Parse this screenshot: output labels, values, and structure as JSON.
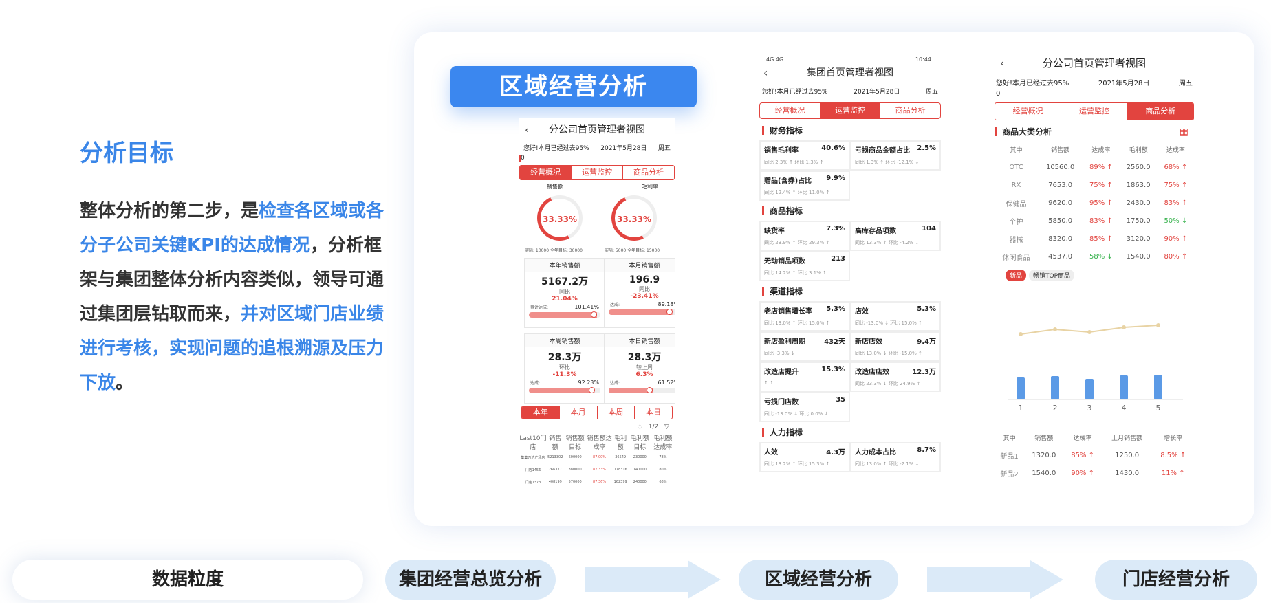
{
  "left": {
    "title": "分析目标",
    "paragraph": [
      {
        "t": "整体分析的第二步，是",
        "hl": false
      },
      {
        "t": "检查各区域或各分子公司关键KPI的达成情况",
        "hl": true
      },
      {
        "t": "，分析框架与集团整体分析内容类似，领导可通过集团层钻取而来，",
        "hl": false
      },
      {
        "t": "并对区域门店业绩进行考核，实现问题的追根溯源及压力下放",
        "hl": true
      },
      {
        "t": "。",
        "hl": false
      }
    ]
  },
  "tag_label": "区域经营分析",
  "phone1": {
    "title": "分公司首页管理者视图",
    "greet": "您好!本月已经过去95%",
    "date": "2021年5月28日",
    "weekday": "周五",
    "zero": "0",
    "tabs": [
      "经营概况",
      "运营监控",
      "商品分析"
    ],
    "gauges": [
      {
        "label": "销售额",
        "value": "33.33%",
        "foot": "实际: 10000    全年目标: 30000"
      },
      {
        "label": "毛利率",
        "value": "33.33%",
        "foot": "实际: 5000    全年目标: 15000"
      }
    ],
    "cards": [
      {
        "title": "本年销售额",
        "value": "5167.2万",
        "sub": "同比",
        "pct": "21.04%",
        "k": "累计达成:",
        "kv": "101.41%",
        "fill": 0.95
      },
      {
        "title": "本月销售额",
        "value": "196.9",
        "sub": "同比",
        "pct": "-23.41%",
        "k": "达成:",
        "kv": "89.18%",
        "fill": 0.89
      },
      {
        "title": "本周销售额",
        "value": "28.3万",
        "sub": "环比",
        "pct": "-11.3%",
        "k": "达成:",
        "kv": "92.23%",
        "fill": 0.92
      },
      {
        "title": "本日销售额",
        "value": "28.3万",
        "sub": "较上周",
        "pct": "6.3%",
        "k": "达成:",
        "kv": "61.52%",
        "fill": 0.62
      }
    ],
    "period_tabs": [
      "本年",
      "本月",
      "本周",
      "本日"
    ],
    "pager": "1/2",
    "table_head": [
      "Last10门店",
      "销售额",
      "销售额目标",
      "销售额达成率",
      "毛利额",
      "毛利额目标",
      "毛利额达成率"
    ],
    "table_rows": [
      [
        "集集万达广场店",
        "5213302",
        "600000",
        "87.00%",
        "36549",
        "230000",
        "78%"
      ],
      [
        "门店1456",
        "266377",
        "380000",
        "87.33%",
        "178316",
        "140000",
        "80%"
      ],
      [
        "门店1373",
        "408199",
        "570000",
        "87.36%",
        "162399",
        "240000",
        "68%"
      ]
    ]
  },
  "phone2": {
    "status_left": "4G 4G",
    "status_right": "10:44",
    "title": "集团首页管理者视图",
    "greet": "您好!本月已经过去95%",
    "date": "2021年5月28日",
    "weekday": "周五",
    "tabs": [
      "经营概况",
      "运营监控",
      "商品分析"
    ],
    "sections": [
      {
        "name": "财务指标",
        "items": [
          {
            "k": "销售毛利率",
            "v": "40.6%",
            "d": "同比 2.3% ↑  环比 1.3% ↑"
          },
          {
            "k": "亏损商品金额占比",
            "v": "2.5%",
            "d": "同比 1.3% ↑  环比 -12.1% ↓"
          },
          {
            "k": "赠品(含券)占比",
            "v": "9.9%",
            "d": "同比 12.4% ↑  环比 11.0% ↑"
          }
        ]
      },
      {
        "name": "商品指标",
        "items": [
          {
            "k": "缺货率",
            "v": "7.3%",
            "d": "同比 23.9% ↑  环比 29.3% ↑"
          },
          {
            "k": "高库存品项数",
            "v": "104",
            "d": "同比 13.3% ↑  环比 -4.2% ↓"
          },
          {
            "k": "无动销品项数",
            "v": "213",
            "d": "同比 14.2% ↑  环比 3.1% ↑"
          }
        ]
      },
      {
        "name": "渠道指标",
        "items": [
          {
            "k": "老店销售增长率",
            "v": "5.3%",
            "d": "同比 13.0% ↑  环比 15.0% ↑"
          },
          {
            "k": "店效",
            "v": "5.3%",
            "d": "同比 -13.0% ↓  环比 15.0% ↑"
          },
          {
            "k": "新店盈利周期",
            "v": "432天",
            "d": "同比 -3.3% ↓"
          },
          {
            "k": "新店店效",
            "v": "9.4万",
            "d": "同比 13.0% ↓  环比 -15.0% ↑"
          },
          {
            "k": "改造店提升",
            "v": "15.3%",
            "d": "↑  ↑"
          },
          {
            "k": "改造店店效",
            "v": "12.3万",
            "d": "同比 23.3% ↓  环比 24.9% ↑"
          },
          {
            "k": "亏损门店数",
            "v": "35",
            "d": "同比 -13.0% ↓  环比 0.0% ↓"
          }
        ]
      },
      {
        "name": "人力指标",
        "items": [
          {
            "k": "人效",
            "v": "4.3万",
            "d": "同比 13.2% ↑  环比 15.3% ↑"
          },
          {
            "k": "人力成本占比",
            "v": "8.7%",
            "d": "同比 13.0% ↑  环比 -2.1% ↓"
          }
        ]
      }
    ]
  },
  "phone3": {
    "title": "分公司首页管理者视图",
    "greet": "您好!本月已经过去95%",
    "date": "2021年5月28日",
    "weekday": "周五",
    "zero": "0",
    "tabs": [
      "经营概况",
      "运营监控",
      "商品分析"
    ],
    "section": "商品大类分析",
    "head": [
      "其中",
      "销售额",
      "达成率",
      "毛利额",
      "达成率"
    ],
    "rows": [
      [
        "OTC",
        "10560.0",
        "89% ↑",
        "2560.0",
        "68% ↑"
      ],
      [
        "RX",
        "7653.0",
        "75% ↑",
        "1863.0",
        "75% ↑"
      ],
      [
        "保健品",
        "9620.0",
        "95% ↑",
        "2430.0",
        "83% ↑"
      ],
      [
        "个护",
        "5850.0",
        "83% ↑",
        "1750.0",
        "50% ↓"
      ],
      [
        "器械",
        "8320.0",
        "85% ↑",
        "3120.0",
        "90% ↑"
      ],
      [
        "休闲食品",
        "4537.0",
        "58% ↓",
        "1540.0",
        "80% ↑"
      ]
    ],
    "chips": [
      "新品",
      "畅销TOP商品"
    ],
    "chart_data": {
      "type": "bar",
      "categories": [
        "1",
        "2",
        "3",
        "4",
        "5"
      ],
      "series": [
        {
          "values": [
            32,
            34,
            30,
            35,
            36
          ]
        },
        {
          "values": [
            55,
            62,
            58,
            65,
            68
          ]
        }
      ]
    },
    "head2": [
      "其中",
      "销售额",
      "达成率",
      "上月销售额",
      "增长率"
    ],
    "rows2": [
      [
        "新品1",
        "1320.0",
        "85% ↑",
        "1250.0",
        "8.5% ↑"
      ],
      [
        "新品2",
        "1540.0",
        "90% ↑",
        "1430.0",
        "11% ↑"
      ]
    ]
  },
  "bottom": {
    "granularity": "数据粒度",
    "steps": [
      "集团经营总览分析",
      "区域经营分析",
      "门店经营分析"
    ]
  },
  "colors": {
    "accent": "#3a86e8",
    "red": "#e2443f",
    "pill": "#dbeaf8"
  }
}
